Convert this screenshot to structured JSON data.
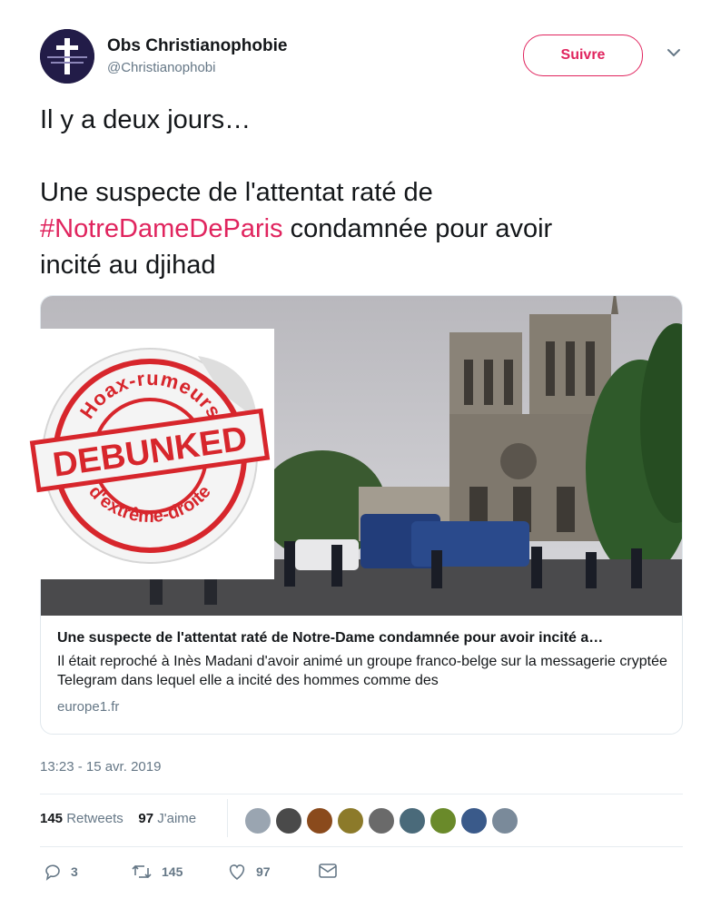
{
  "account": {
    "name": "Obs Christianophobie",
    "handle": "@Christianophobi",
    "follow_label": "Suivre"
  },
  "tweet": {
    "line1": "Il y a deux jours…",
    "line2_pre": "Une suspecte de l'attentat raté de",
    "hashtag": "#NotreDameDeParis",
    "line2_post": " condamnée pour avoir",
    "line3": "incité au djihad"
  },
  "sticker": {
    "top_text": "Hoax-rumeurs",
    "middle_text": "DEBUNKED",
    "bottom_text": "d'extrême-droite",
    "color": "#d7262c"
  },
  "card": {
    "title": "Une suspecte de l'attentat raté de Notre-Dame condamnée pour avoir incité a…",
    "description": "Il était reproché à Inès Madani d'avoir animé un groupe franco-belge sur la messagerie cryptée Telegram dans lequel elle a incité des hommes comme des",
    "domain": "europe1.fr"
  },
  "timestamp": "13:23 - 15 avr. 2019",
  "stats": {
    "retweets_count": "145",
    "retweets_label": "Retweets",
    "likes_count": "97",
    "likes_label": "J'aime"
  },
  "actions": {
    "replies": "3",
    "retweets": "145",
    "likes": "97"
  },
  "colors": {
    "accent": "#e0245e",
    "muted": "#657786",
    "text": "#14171a"
  }
}
